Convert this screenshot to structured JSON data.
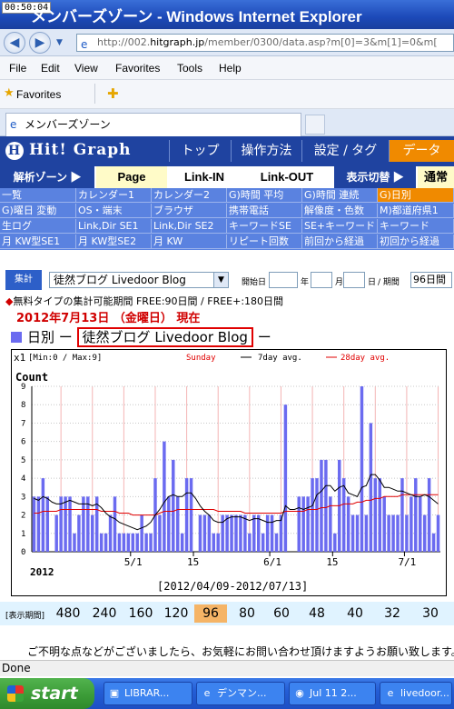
{
  "window": {
    "clock": "00:50:04",
    "title": "メンバーズゾーン - Windows Internet Explorer"
  },
  "address": {
    "url_pre": "http://002.",
    "url_host": "hitgraph.jp",
    "url_post": "/member/0300/data.asp?m[0]=3&m[1]=0&m["
  },
  "menu": [
    "File",
    "Edit",
    "View",
    "Favorites",
    "Tools",
    "Help"
  ],
  "favorites": {
    "label": "Favorites"
  },
  "tab": {
    "label": "メンバーズゾーン"
  },
  "site": {
    "logo": "Hit! Graph",
    "logo_mark": "H",
    "top_nav": [
      {
        "label": "トップ",
        "active": false
      },
      {
        "label": "操作方法",
        "active": false
      },
      {
        "label": "設定 / タグ",
        "active": false
      },
      {
        "label": "データ",
        "active": true
      }
    ],
    "sub_nav": {
      "zone": "解析ゾーン ▶",
      "page": "Page",
      "link_in": "Link-IN",
      "link_out": "Link-OUT",
      "display_switch": "表示切替 ▶",
      "normal": "通常"
    },
    "grid_menu": [
      [
        "一覧",
        "カレンダー1",
        "カレンダー2",
        "G)時間 平均",
        "G)時間 連続",
        "G)日別"
      ],
      [
        "G)曜日 変動",
        "OS・端末",
        "ブラウザ",
        "携帯電話",
        "解像度・色数",
        "M)都道府県1"
      ],
      [
        "生ログ",
        "Link,Dir SE1",
        "Link,Dir SE2",
        "キーワードSE",
        "SE+キーワード",
        "キーワード"
      ],
      [
        "月 KW型SE1",
        "月 KW型SE2",
        "月 KW",
        "リピート回数",
        "前回から経過",
        "初回から経過"
      ]
    ],
    "grid_active": "G)日別"
  },
  "controls": {
    "agg_label": "集計",
    "site_select": "徒然ブログ Livedoor Blog",
    "start_label": "開始日",
    "year_label": "年",
    "month_label": "月",
    "day_label": "日",
    "period_label": "/ 期間",
    "period_value": "96日間"
  },
  "notice": {
    "mark": "◆",
    "text": "無料タイプの集計可能期間 FREE:90日間 / FREE+:180日間"
  },
  "date_line": "2012年7月13日 （金曜日） 現在",
  "section": {
    "prefix": "日別 ー ",
    "blog": "徒然ブログ Livedoor Blog",
    "suffix": " ー"
  },
  "chart_data": {
    "type": "bar",
    "scale_label": "x1",
    "minmax": "[Min:0 / Max:9]",
    "legend": {
      "sunday": "Sunday",
      "avg7": "7day avg.",
      "avg28": "28day avg."
    },
    "ylabel": "Count",
    "ylim": [
      0,
      9
    ],
    "yticks": [
      0,
      1,
      2,
      3,
      4,
      5,
      6,
      7,
      8,
      9
    ],
    "xtick_labels": [
      {
        "index": 22,
        "label": "5/1"
      },
      {
        "index": 36,
        "label": "15"
      },
      {
        "index": 53,
        "label": "6/1"
      },
      {
        "index": 67,
        "label": "15"
      },
      {
        "index": 83,
        "label": "7/1"
      }
    ],
    "year_label": "2012",
    "range_caption": "[2012/04/09-2012/07/13]",
    "colors": {
      "bar": "#6b6bf0",
      "avg7": "#000000",
      "avg28": "#e00000",
      "sunday_grid": "#f4b4b4"
    },
    "values": [
      3,
      3,
      4,
      3,
      0,
      2,
      3,
      3,
      3,
      1,
      2,
      3,
      3,
      2,
      3,
      1,
      1,
      2,
      3,
      1,
      1,
      1,
      1,
      1,
      2,
      1,
      1,
      4,
      2,
      6,
      3,
      5,
      3,
      1,
      4,
      4,
      0,
      2,
      2,
      2,
      1,
      1,
      2,
      2,
      2,
      2,
      2,
      2,
      1,
      2,
      2,
      1,
      2,
      2,
      1,
      2,
      8,
      0,
      0,
      3,
      3,
      3,
      4,
      4,
      5,
      5,
      3,
      1,
      5,
      4,
      3,
      2,
      2,
      9,
      2,
      7,
      4,
      4,
      3,
      2,
      2,
      2,
      4,
      2,
      3,
      4,
      3,
      2,
      4,
      1,
      2
    ],
    "avg7": [
      2.9,
      2.8,
      3.0,
      2.9,
      2.7,
      2.6,
      2.6,
      2.7,
      2.8,
      2.7,
      2.6,
      2.6,
      2.6,
      2.5,
      2.6,
      2.4,
      2.1,
      1.9,
      1.8,
      1.6,
      1.5,
      1.4,
      1.3,
      1.2,
      1.3,
      1.4,
      1.6,
      2.0,
      2.3,
      2.7,
      3.0,
      3.1,
      3.0,
      3.0,
      3.2,
      3.2,
      2.9,
      2.5,
      2.2,
      2.0,
      1.7,
      1.6,
      1.6,
      1.8,
      1.9,
      1.9,
      1.9,
      1.8,
      1.7,
      1.8,
      1.8,
      1.7,
      1.6,
      1.6,
      1.7,
      1.7,
      2.5,
      2.3,
      2.3,
      2.4,
      2.3,
      2.4,
      2.5,
      3.1,
      3.3,
      3.6,
      3.6,
      3.3,
      3.5,
      3.6,
      3.2,
      3.1,
      3.0,
      3.5,
      3.6,
      4.2,
      4.2,
      3.9,
      3.5,
      3.5,
      3.4,
      3.3,
      3.3,
      3.2,
      3.1,
      3.0,
      3.0,
      3.1,
      3.0,
      2.8,
      2.6
    ],
    "avg28": [
      2.1,
      2.1,
      2.2,
      2.2,
      2.2,
      2.2,
      2.3,
      2.3,
      2.3,
      2.3,
      2.3,
      2.3,
      2.3,
      2.3,
      2.3,
      2.2,
      2.2,
      2.2,
      2.2,
      2.1,
      2.1,
      2.1,
      2.0,
      2.0,
      2.0,
      2.0,
      2.0,
      2.0,
      2.1,
      2.2,
      2.2,
      2.2,
      2.3,
      2.3,
      2.3,
      2.3,
      2.3,
      2.3,
      2.3,
      2.3,
      2.3,
      2.2,
      2.2,
      2.2,
      2.2,
      2.2,
      2.2,
      2.1,
      2.1,
      2.1,
      2.1,
      2.1,
      2.1,
      2.1,
      2.1,
      2.1,
      2.2,
      2.2,
      2.2,
      2.2,
      2.2,
      2.3,
      2.3,
      2.3,
      2.4,
      2.4,
      2.5,
      2.5,
      2.5,
      2.6,
      2.6,
      2.6,
      2.7,
      2.7,
      2.8,
      2.8,
      2.9,
      2.9,
      3.0,
      3.0,
      3.0,
      3.0,
      3.1,
      3.1,
      3.1,
      3.1,
      3.1,
      3.1,
      3.1,
      3.1,
      3.1
    ]
  },
  "range_bar": {
    "label": "[表示期間]",
    "items": [
      "480",
      "240",
      "160",
      "120",
      "96",
      "80",
      "60",
      "48",
      "40",
      "32",
      "30"
    ],
    "active": "96"
  },
  "footer": "ご不明な点などがございましたら、お気軽にお問い合わせ頂けますようお願い致します。",
  "status": "Done",
  "taskbar": {
    "start": "start",
    "tasks": [
      "LIBRAR...",
      "デンマン...",
      "Jul 11 2...",
      "livedoor..."
    ]
  }
}
